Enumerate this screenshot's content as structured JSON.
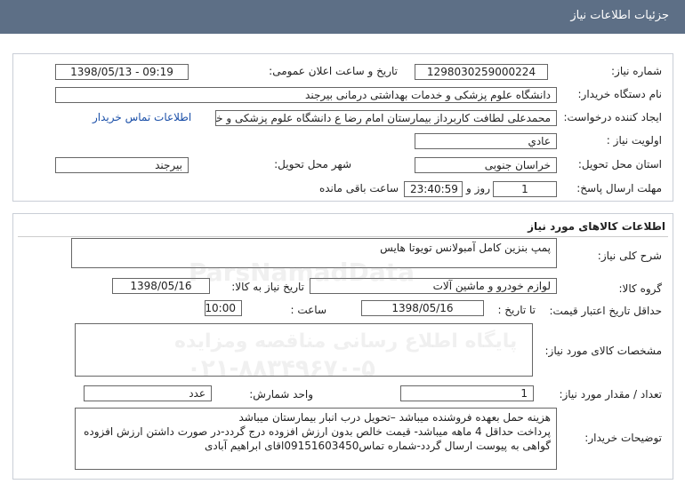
{
  "header": {
    "title": "جزئيات اطلاعات نياز"
  },
  "info": {
    "need_number_label": "شماره نیاز:",
    "need_number": "1298030259000224",
    "announce_label": "تاریخ و ساعت اعلان عمومی:",
    "announce_value": "1398/05/13 - 09:19",
    "buyer_label": "نام دستگاه خریدار:",
    "buyer_value": "دانشگاه علوم پزشکی و خدمات بهداشتی درمانی بیرجند",
    "creator_label": "ایجاد کننده درخواست:",
    "creator_value": "محمدعلی لطافت کاربرداز بیمارستان امام رضا ع دانشگاه علوم پزشکی و خدمات",
    "contact_link": "اطلاعات تماس خریدار",
    "priority_label": "اولویت نیاز :",
    "priority_value": "عادي",
    "province_label": "استان محل تحویل:",
    "province_value": "خراسان جنوبی",
    "city_label": "شهر محل تحویل:",
    "city_value": "بیرجند",
    "deadline_label": "مهلت ارسال پاسخ:",
    "deadline_days": "1",
    "days_word": "روز و",
    "deadline_time": "23:40:59",
    "remaining_word": "ساعت باقی مانده"
  },
  "goods": {
    "section_title": "اطلاعات کالاهای مورد نیاز",
    "general_desc_label": "شرح کلی نیاز:",
    "general_desc_value": "پمپ بنزین کامل آمبولانس تویوتا هایس",
    "group_label": "گروه کالا:",
    "group_value": "لوازم خودرو و ماشین آلات",
    "need_date_label": "تاریخ نیاز به کالا:",
    "need_date_value": "1398/05/16",
    "validity_label": "حداقل تاریخ اعتبار قیمت:",
    "until_date_label": "تا تاریخ :",
    "until_date_value": "1398/05/16",
    "time_label": "ساعت :",
    "time_value": "10:00",
    "specs_label": "مشخصات کالای مورد نیاز:",
    "specs_value": "",
    "qty_label": "تعداد / مقدار مورد نیاز:",
    "qty_value": "1",
    "unit_label": "واحد شمارش:",
    "unit_value": "عدد",
    "buyer_notes_label": "توضیحات خریدار:",
    "buyer_notes_lines": [
      "هزینه حمل بعهده فروشنده میباشد –تحویل درب انبار بیمارستان میباشد",
      "پرداخت حداقل 4 ماهه میباشد- قیمت خالص بدون ارزش افزوده درج گردد-در صورت داشتن ارزش افزوده",
      "گواهی به پیوست ارسال گردد-شماره تماس09151603450اقای ابراهیم آبادی"
    ]
  },
  "watermark": {
    "brand": "ParsNamadData",
    "line1": "پایگاه اطلاع رسانی مناقصه ومزایده",
    "line2": "۰۲۱-۸۸۳۴۹۶۷۰-۵"
  }
}
